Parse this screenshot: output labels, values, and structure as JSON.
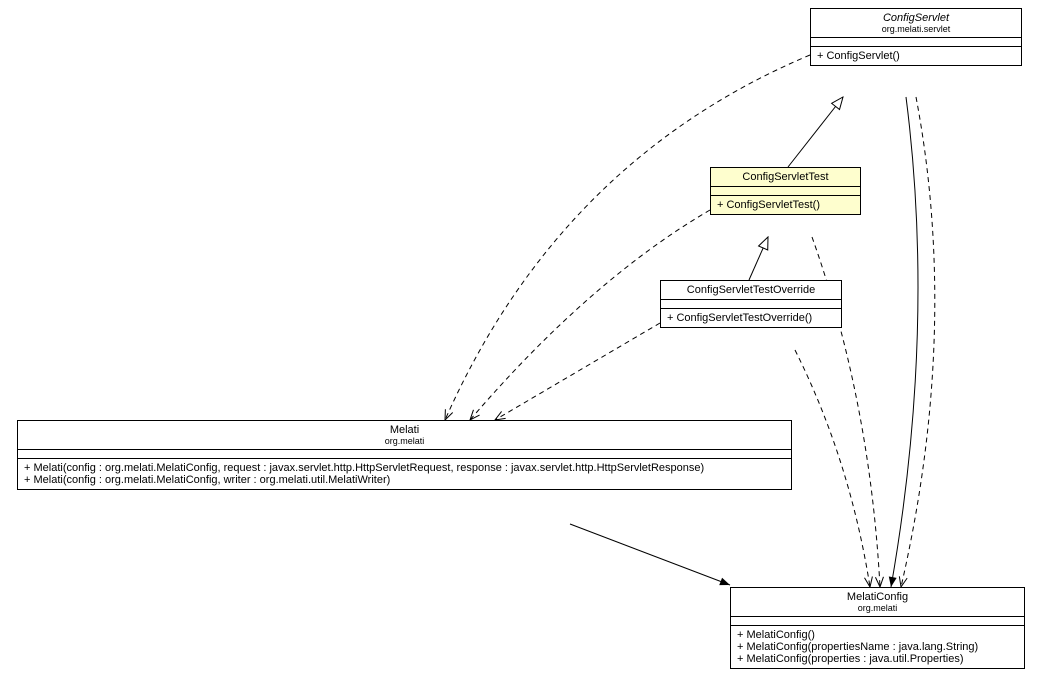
{
  "classes": {
    "configServlet": {
      "name": "ConfigServlet",
      "pkg": "org.melati.servlet",
      "methods": [
        "+ ConfigServlet()"
      ]
    },
    "configServletTest": {
      "name": "ConfigServletTest",
      "methods": [
        "+ ConfigServletTest()"
      ]
    },
    "configServletTestOverride": {
      "name": "ConfigServletTestOverride",
      "methods": [
        "+ ConfigServletTestOverride()"
      ]
    },
    "melati": {
      "name": "Melati",
      "pkg": "org.melati",
      "methods": [
        "+ Melati(config : org.melati.MelatiConfig, request : javax.servlet.http.HttpServletRequest, response : javax.servlet.http.HttpServletResponse)",
        "+ Melati(config : org.melati.MelatiConfig, writer : org.melati.util.MelatiWriter)"
      ]
    },
    "melatiConfig": {
      "name": "MelatiConfig",
      "pkg": "org.melati",
      "methods": [
        "+ MelatiConfig()",
        "+ MelatiConfig(propertiesName : java.lang.String)",
        "+ MelatiConfig(properties : java.util.Properties)"
      ]
    }
  }
}
